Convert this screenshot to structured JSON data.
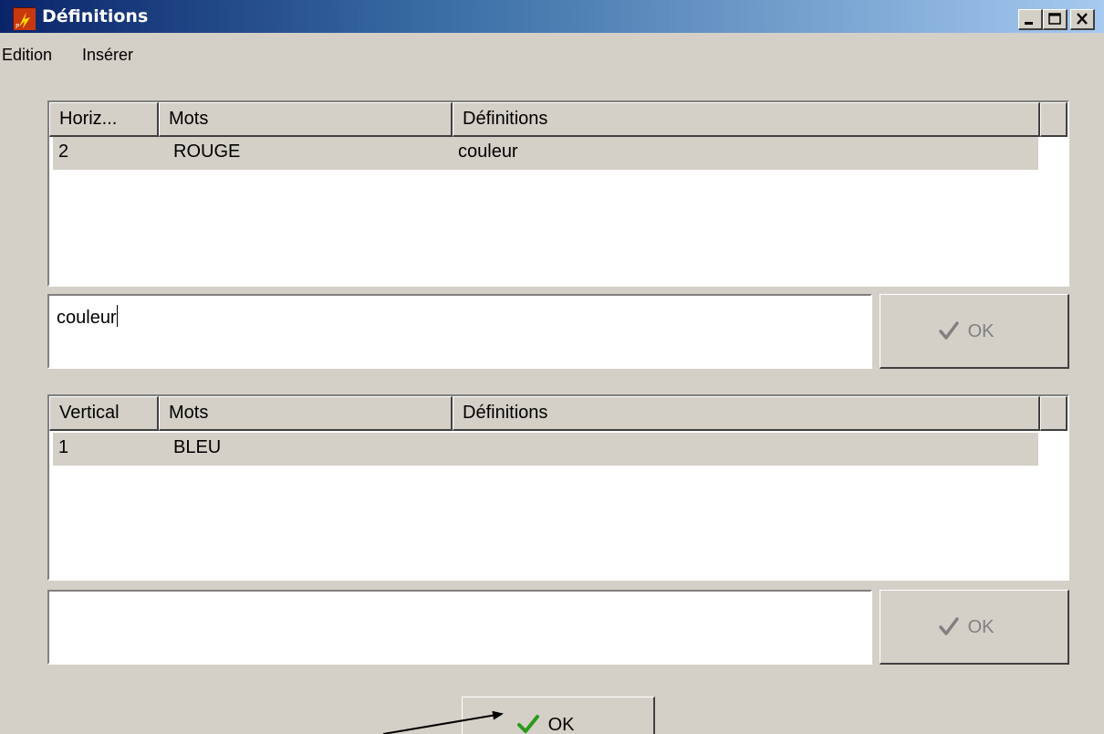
{
  "window": {
    "title": "Définitions",
    "controls": [
      "minimize",
      "maximize",
      "close"
    ]
  },
  "menu": {
    "items": [
      "Edition",
      "Insérer"
    ]
  },
  "horizontal": {
    "headers": [
      "Horiz...",
      "Mots",
      "Définitions"
    ],
    "rows": [
      {
        "num": "2",
        "word": "ROUGE",
        "definition": "couleur"
      }
    ],
    "edit_value": "couleur",
    "ok_label": "OK"
  },
  "vertical": {
    "headers": [
      "Vertical",
      "Mots",
      "Définitions"
    ],
    "rows": [
      {
        "num": "1",
        "word": "BLEU",
        "definition": ""
      }
    ],
    "edit_value": "",
    "ok_label": "OK"
  },
  "main_ok": {
    "label": "OK"
  },
  "colors": {
    "face": "#d4d0c8",
    "title_start": "#0a246a",
    "title_end": "#a6caf0",
    "check_green": "#2a9a1a",
    "check_gray": "#808080"
  },
  "icons": {
    "app": "crossword-app-icon",
    "check": "checkmark-icon"
  }
}
